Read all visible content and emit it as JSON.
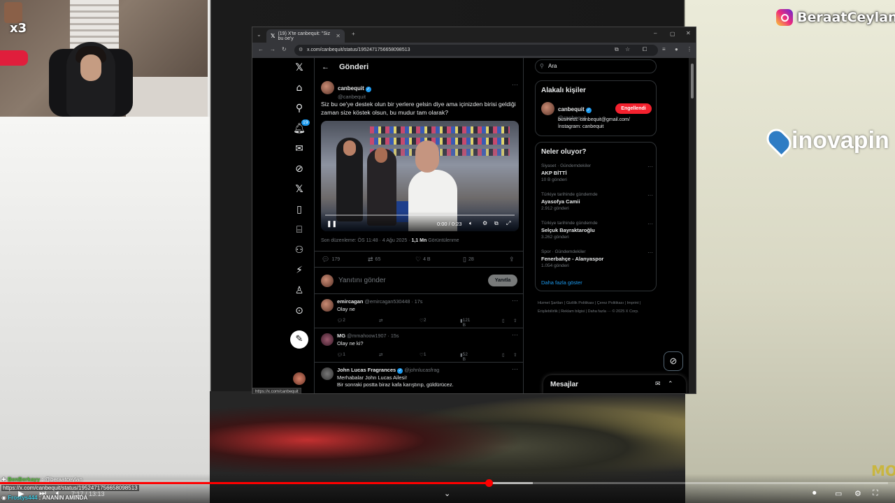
{
  "streamer": {
    "instagram_name": "BeraatCeylan",
    "webcam_counter": "x3",
    "sponsor": "inovapin",
    "corner_logo": "MO"
  },
  "browser": {
    "tab_title": "(19) X'te canbequit: \"Siz bu oe'y",
    "url": "x.com/canbequit/status/1952471756658098513",
    "hover_url": "https://x.com/canbequit"
  },
  "x": {
    "header_title": "Gönderi",
    "notifications_badge": "19",
    "tweet": {
      "name": "canbequit",
      "handle": "@canbequit",
      "text": "Siz bu oe'ye destek olun bir yerlere gelsin diye ama içinizden birisi geldiği zaman size köstek olsun, bu mudur tam olarak?",
      "video_time": "0:00 / 0:23",
      "edited": "Son düzenleme: ÖS 11:48 · 4 Ağu 2025 · ",
      "views_value": "1,1 Mn",
      "views_label": " Görüntülenme",
      "replies": "179",
      "reposts": "65",
      "likes": "4 B",
      "bookmarks": "28"
    },
    "reply_box": {
      "placeholder": "Yanıtını gönder",
      "button": "Yanıtla"
    },
    "replies": [
      {
        "name": "emircagan",
        "handle": "@emircagan530448 · 17s",
        "text": "Olay ne",
        "replies": "2",
        "likes": "2",
        "views": "121 B"
      },
      {
        "name": "MG",
        "handle": "@mmahoow1907 · 15s",
        "text": "Olay ne ki?",
        "replies": "1",
        "likes": "1",
        "views": "52 B"
      },
      {
        "name": "John Lucas Fragrances",
        "handle": "@johnlucasfrag",
        "text": "Merhabalar John Lucas Ailesi!\nBir sonraki postta biraz kafa karıştırıp, güldürücez."
      }
    ],
    "search_placeholder": "Ara",
    "related": {
      "title": "Alakalı kişiler",
      "name": "canbequit",
      "handle": "@canbequit",
      "button": "Engellendi",
      "bio1": "business: canbequit@gmail.com/",
      "bio2": "İnstagram: canbequit"
    },
    "trends": {
      "title": "Neler oluyor?",
      "items": [
        {
          "category": "Siyaset · Gündemdekiler",
          "title": "AKP BİTTİ",
          "count": "10 B gönderi"
        },
        {
          "category": "Türkiye tarihinde gündemde",
          "title": "Ayasofya Camii",
          "count": "2.912 gönderi"
        },
        {
          "category": "Türkiye tarihinde gündemde",
          "title": "Selçuk Bayraktaroğlu",
          "count": "3.262 gönderi"
        },
        {
          "category": "Spor · Gündemdekiler",
          "title": "Fenerbahçe - Alanyaspor",
          "count": "1.054 gönderi"
        }
      ],
      "show_more": "Daha fazla göster"
    },
    "footer": "Hizmet Şartları | Gizlilik Politikası | Çerez Politikası | Imprint | Erişilebilirlik | Reklam bilgisi | Daha fazla ··· © 2025 X Corp.",
    "messages": "Mesajlar"
  },
  "youtube": {
    "chat1_user": "BenBerkayy",
    "chat1_text": " : @beraatceylan",
    "link": "https://x.com/canbequit/status/1952471756658098513",
    "chat2_user": "Frostys444",
    "chat2_text": " : ANANIN AMINDA",
    "time": "7:17 / 13:13",
    "progress_fraction": 0.55,
    "buffer_fraction": 0.6
  },
  "colors": {
    "accent": "#1d9bf0",
    "block": "#f4212e",
    "yt_red": "#ff0000"
  }
}
